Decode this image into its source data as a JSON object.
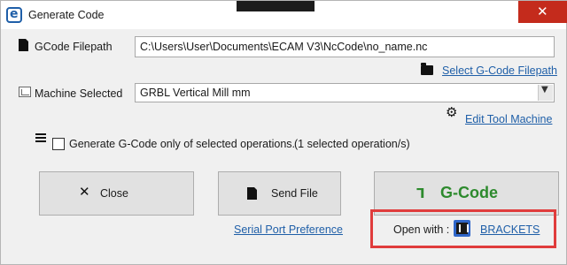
{
  "window": {
    "title": "Generate Code",
    "close_glyph": "✕"
  },
  "gcode_filepath": {
    "label": "GCode Filepath",
    "value": "C:\\Users\\User\\Documents\\ECAM V3\\NcCode\\no_name.nc",
    "select_link": "Select G-Code Filepath"
  },
  "machine": {
    "label": "Machine Selected",
    "selected": "GRBL Vertical Mill mm",
    "edit_link": "Edit Tool Machine"
  },
  "options": {
    "generate_selected_label": "Generate G-Code only of selected operations.",
    "generate_selected_checked": false,
    "selected_count_text": "(1 selected operation/s)"
  },
  "buttons": {
    "close_label": "Close",
    "send_file_label": "Send File",
    "gcode_label": "G-Code"
  },
  "footer": {
    "serial_port_link": "Serial Port Preference",
    "open_with_label": "Open with :",
    "open_with_app": "BRACKETS"
  },
  "icons": {
    "app": "ecam-app-icon",
    "file": "file-icon",
    "folder": "folder-icon",
    "machine": "machine-icon",
    "gear": "gear-icon",
    "list": "list-icon",
    "close_x": "close-icon",
    "send": "send-file-icon",
    "gcode": "gcode-icon",
    "brackets": "brackets-icon"
  },
  "colors": {
    "accent_link": "#1f5fa8",
    "gcode_green": "#2d8a2d",
    "close_red": "#c42b1c",
    "highlight_red": "#e03c3c"
  }
}
